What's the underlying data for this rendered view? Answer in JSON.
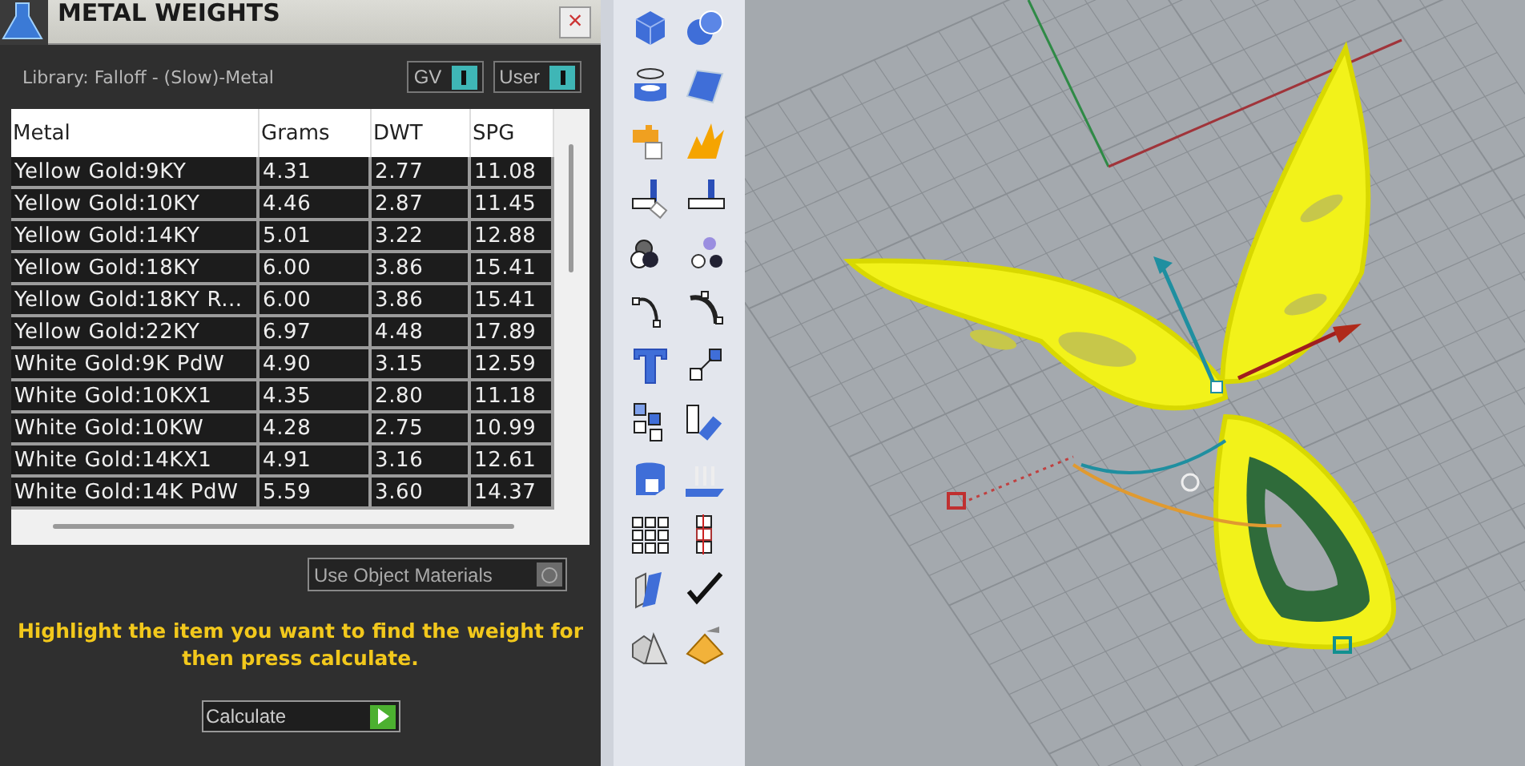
{
  "panel": {
    "title": "METAL WEIGHTS",
    "close": "×",
    "library": "Library: Falloff - (Slow)-Metal",
    "toggles": [
      {
        "label": "GV",
        "on": true
      },
      {
        "label": "User",
        "on": true
      }
    ],
    "table": {
      "columns": [
        "Metal",
        "Grams",
        "DWT",
        "SPG"
      ],
      "rows": [
        [
          "Yellow Gold:9KY",
          "4.31",
          "2.77",
          "11.08"
        ],
        [
          "Yellow Gold:10KY",
          "4.46",
          "2.87",
          "11.45"
        ],
        [
          "Yellow Gold:14KY",
          "5.01",
          "3.22",
          "12.88"
        ],
        [
          "Yellow Gold:18KY",
          "6.00",
          "3.86",
          "15.41"
        ],
        [
          "Yellow Gold:18KY R...",
          "6.00",
          "3.86",
          "15.41"
        ],
        [
          "Yellow Gold:22KY",
          "6.97",
          "4.48",
          "17.89"
        ],
        [
          "White Gold:9K PdW",
          "4.90",
          "3.15",
          "12.59"
        ],
        [
          "White Gold:10KX1",
          "4.35",
          "2.80",
          "11.18"
        ],
        [
          "White Gold:10KW",
          "4.28",
          "2.75",
          "10.99"
        ],
        [
          "White Gold:14KX1",
          "4.91",
          "3.16",
          "12.61"
        ],
        [
          "White Gold:14K PdW",
          "5.59",
          "3.60",
          "14.37"
        ]
      ]
    },
    "object_materials": {
      "label": "Use Object Materials",
      "on": false
    },
    "hint": "Highlight the item you want to find the weight for then press calculate.",
    "calculate": "Calculate"
  }
}
